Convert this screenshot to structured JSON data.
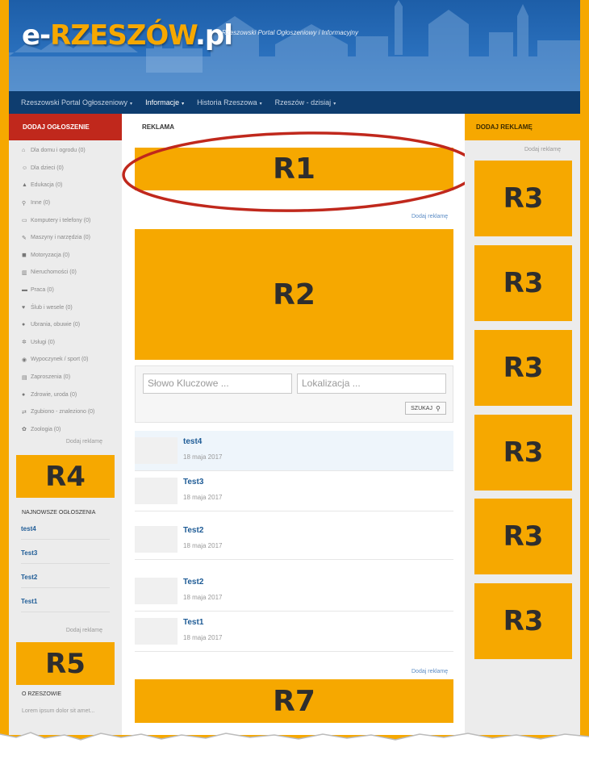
{
  "header": {
    "logo_prefix": "e-",
    "logo_city": "RZESZÓW",
    "logo_suffix": ".pl",
    "tagline": "Rzeszowski Portal Ogłoszeniowy i Informacyjny"
  },
  "nav": {
    "items": [
      {
        "label": "Rzeszowski Portal Ogłoszeniowy",
        "caret": "▾"
      },
      {
        "label": "Informacje",
        "caret": "▾"
      },
      {
        "label": "Historia Rzeszowa",
        "caret": "▾"
      },
      {
        "label": "Rzeszów - dzisiaj",
        "caret": "▾"
      }
    ]
  },
  "left": {
    "header": "DODAJ OGŁOSZENIE",
    "categories": [
      {
        "label": "Dla domu i ogrodu (0)",
        "icon": "home-icon"
      },
      {
        "label": "Dla dzieci (0)",
        "icon": "smile-icon"
      },
      {
        "label": "Edukacja (0)",
        "icon": "graduation-cap-icon"
      },
      {
        "label": "Inne (0)",
        "icon": "search-icon"
      },
      {
        "label": "Komputery i telefony (0)",
        "icon": "laptop-icon"
      },
      {
        "label": "Maszyny i narzędzia (0)",
        "icon": "wrench-icon"
      },
      {
        "label": "Motoryzacja (0)",
        "icon": "car-icon"
      },
      {
        "label": "Nieruchomości (0)",
        "icon": "bank-icon"
      },
      {
        "label": "Praca (0)",
        "icon": "briefcase-icon"
      },
      {
        "label": "Ślub i wesele (0)",
        "icon": "heart-icon"
      },
      {
        "label": "Ubrania, obuwie (0)",
        "icon": "users-icon"
      },
      {
        "label": "Usługi (0)",
        "icon": "gears-icon"
      },
      {
        "label": "Wypoczynek / sport (0)",
        "icon": "soccer-ball-icon"
      },
      {
        "label": "Zaproszenia (0)",
        "icon": "newspaper-icon"
      },
      {
        "label": "Zdrowie, uroda (0)",
        "icon": "drop-icon"
      },
      {
        "label": "Zgubiono - znaleziono (0)",
        "icon": "retweet-icon"
      },
      {
        "label": "Zoologia (0)",
        "icon": "paw-icon"
      }
    ],
    "add_ad_link_1": "Dodaj reklamę",
    "ad_r4": "R4",
    "latest_title": "NAJNOWSZE OGŁOSZENIA",
    "latest": [
      "test4",
      "Test3",
      "Test2",
      "Test1"
    ],
    "add_ad_link_2": "Dodaj reklamę",
    "ad_r5": "R5",
    "about_title": "O RZESZOWIE",
    "about_text": "Lorem ipsum dolor sit amet..."
  },
  "main": {
    "header": "REKLAMA",
    "ad_r1": "R1",
    "add_ad_link_1": "Dodaj reklamę",
    "ad_r2": "R2",
    "search": {
      "keyword_placeholder": "Słowo Kluczowe ...",
      "location_placeholder": "Lokalizacja ...",
      "button_label": "SZUKAJ"
    },
    "listings": [
      {
        "title": "test4",
        "date": "18 maja 2017",
        "highlighted": true
      },
      {
        "title": "Test3",
        "date": "18 maja 2017",
        "highlighted": false
      },
      {
        "title": "Test2",
        "date": "18 maja 2017",
        "highlighted": false
      },
      {
        "title": "Test2",
        "date": "18 maja 2017",
        "highlighted": false
      },
      {
        "title": "Test1",
        "date": "18 maja 2017",
        "highlighted": false
      }
    ],
    "add_ad_link_2": "Dodaj reklamę",
    "ad_r7": "R7"
  },
  "right": {
    "header": "DODAJ REKLAMĘ",
    "add_ad_link": "Dodaj reklamę",
    "ads": [
      "R3",
      "R3",
      "R3",
      "R3",
      "R3",
      "R3"
    ]
  },
  "colors": {
    "accent_orange": "#f6a800",
    "header_red": "#c0281c",
    "nav_blue": "#0e3d6f",
    "link_blue": "#1f5c96",
    "annotation_red": "#c0281c"
  }
}
